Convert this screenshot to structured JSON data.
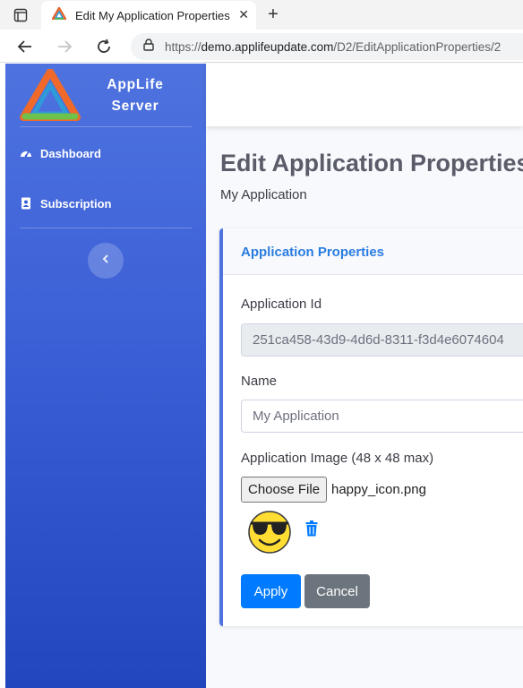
{
  "browser": {
    "tab_title": "Edit My Application Properties",
    "url_prefix": "https://",
    "url_host": "demo.applifeupdate.com",
    "url_path": "/D2/EditApplicationProperties/2"
  },
  "sidebar": {
    "brand_line1": "AppLife",
    "brand_line2": "Server",
    "items": [
      {
        "label": "Dashboard",
        "icon": "tachometer-icon"
      },
      {
        "label": "Subscription",
        "icon": "address-book-icon"
      }
    ],
    "toggle_icon": "chevron-left-icon"
  },
  "page": {
    "title": "Edit Application Properties",
    "subtitle": "My Application"
  },
  "card": {
    "header": "Application Properties",
    "app_id_label": "Application Id",
    "app_id_value": "251ca458-43d9-4d6d-8311-f3d4e6074604",
    "name_label": "Name",
    "name_value": "My Application",
    "image_label": "Application Image (48 x 48 max)",
    "choose_file_label": "Choose File",
    "file_name": "happy_icon.png",
    "apply_label": "Apply",
    "cancel_label": "Cancel"
  },
  "colors": {
    "sidebar_top": "#4e73df",
    "sidebar_bottom": "#2246be",
    "primary": "#007bff",
    "secondary": "#6c757d",
    "card_accent": "#4e73df"
  }
}
